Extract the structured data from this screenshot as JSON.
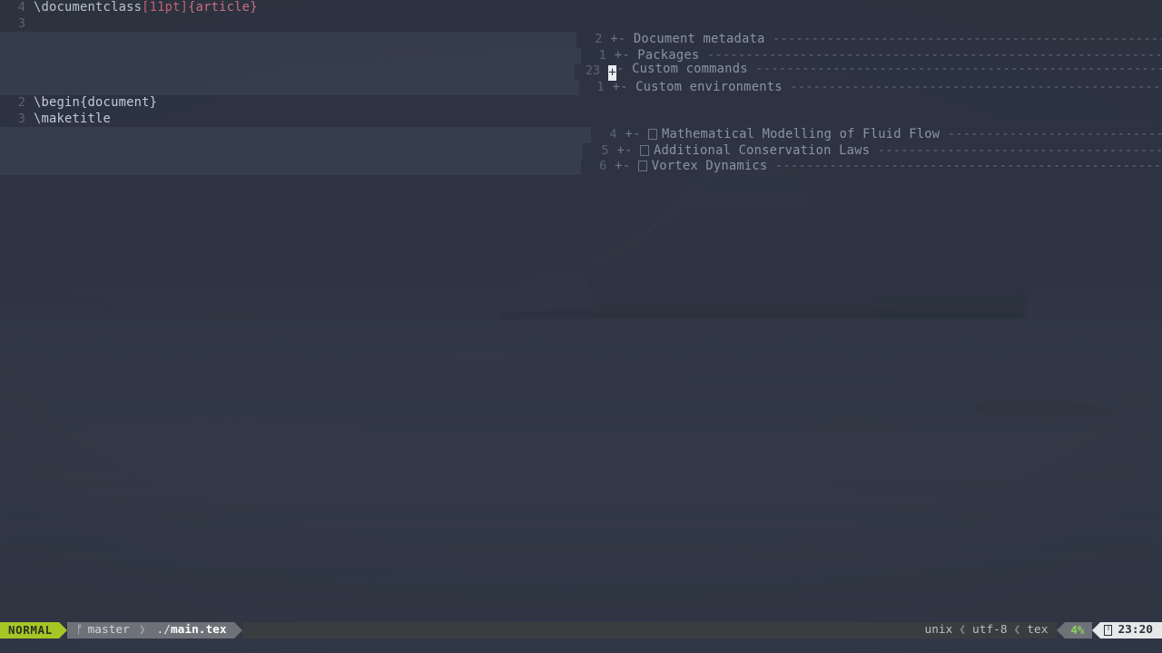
{
  "app": {
    "name": "neovim",
    "window_title": "main.tex"
  },
  "editor": {
    "filetype": "tex",
    "lines": [
      {
        "number": "4",
        "kind": "code",
        "current": false,
        "segments": [
          {
            "text": "\\documentclass",
            "style": "c-cmd"
          },
          {
            "text": "[11pt]",
            "style": "c-opt"
          },
          {
            "text": "{article}",
            "style": "c-arg"
          }
        ]
      },
      {
        "number": "3",
        "kind": "code",
        "current": false,
        "segments": []
      },
      {
        "number": "2",
        "kind": "fold",
        "current": false,
        "marker": "+-",
        "glyph": "",
        "name": "Document metadata"
      },
      {
        "number": "1",
        "kind": "fold",
        "current": false,
        "marker": "+-",
        "glyph": "",
        "name": "Packages"
      },
      {
        "number": "23",
        "kind": "fold",
        "current": true,
        "marker": "+-",
        "cursor_char": "+",
        "glyph": "",
        "name": "Custom commands"
      },
      {
        "number": "1",
        "kind": "fold",
        "current": false,
        "marker": "+-",
        "glyph": "",
        "name": "Custom environments"
      },
      {
        "number": "2",
        "kind": "code",
        "current": false,
        "segments": [
          {
            "text": "\\begin{document}",
            "style": "c-plain"
          }
        ]
      },
      {
        "number": "3",
        "kind": "code",
        "current": false,
        "segments": [
          {
            "text": "\\maketitle",
            "style": "c-plain"
          }
        ]
      },
      {
        "number": "4",
        "kind": "fold",
        "current": false,
        "marker": "+-",
        "glyph": "□",
        "name": "Mathematical Modelling of Fluid Flow"
      },
      {
        "number": "5",
        "kind": "fold",
        "current": false,
        "marker": "+-",
        "glyph": "□",
        "name": "Additional Conservation Laws"
      },
      {
        "number": "6",
        "kind": "fold",
        "current": false,
        "marker": "+-",
        "glyph": "□",
        "name": "Vortex Dynamics"
      }
    ],
    "fold_fill_char": "-"
  },
  "statusline": {
    "mode": "NORMAL",
    "git_icon": "ᚠ",
    "git_branch": "master",
    "file_dir": "./",
    "file_name": "main.tex",
    "fileformat": "unix",
    "encoding": "utf-8",
    "filetype": "tex",
    "percent": "4%",
    "battery_icon": "battery-icon",
    "time": "23:20"
  },
  "colors": {
    "mode_accent": "#a5c726",
    "statusline_b": "#6e7278",
    "statusline_c": "#3a3d40",
    "statusline_y": "#e6e8ea",
    "editor_bg": "#2e3440",
    "fold_bg": "#4c566a",
    "percent_green": "#8fd35a",
    "time_colon_green": "#3d7a2e"
  }
}
